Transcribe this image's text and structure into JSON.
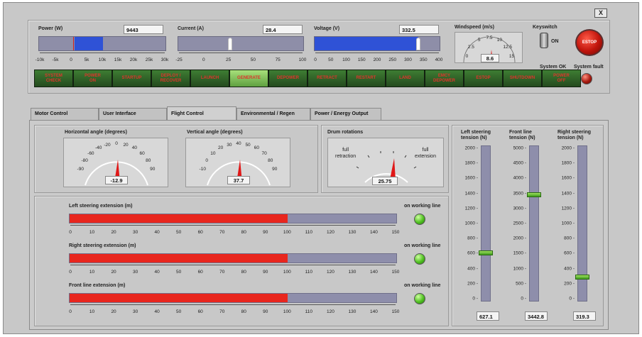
{
  "window": {
    "close_label": "X"
  },
  "power": {
    "label": "Power (W)",
    "value": "9443",
    "ticks": [
      "-10k",
      "-5k",
      "0",
      "5k",
      "10k",
      "15k",
      "20k",
      "25k",
      "30k"
    ],
    "fraction": 0.49
  },
  "current": {
    "label": "Current (A)",
    "value": "28.4",
    "ticks": [
      "-25",
      "0",
      "25",
      "50",
      "75",
      "100"
    ],
    "fraction": 0.41
  },
  "voltage": {
    "label": "Voltage (V)",
    "value": "332.5",
    "ticks": [
      "0",
      "50",
      "100",
      "150",
      "200",
      "250",
      "300",
      "350",
      "400"
    ],
    "fraction": 0.83
  },
  "windspeed": {
    "label": "Windspeed (m/s)",
    "value": "8.6",
    "ticks": [
      "0",
      "2.5",
      "5",
      "7.5",
      "10",
      "12.5",
      "15"
    ]
  },
  "keyswitch": {
    "label": "Keyswitch",
    "state": "ON"
  },
  "estop": {
    "label": "ESTOP"
  },
  "status": {
    "ok_label": "System OK",
    "fault_label": "System fault"
  },
  "buttons": [
    "SYSTEM\nCHECK",
    "POWER\nON",
    "STARTUP",
    "DEPLOY /\nRECOVER",
    "LAUNCH",
    "GENERATE",
    "DEPOWER",
    "RETRACT",
    "RESTART",
    "LAND",
    "EMCY\nDEPOWER",
    "ESTOP",
    "SHUTDOWN",
    "POWER\nOFF"
  ],
  "active_button": "GENERATE",
  "tabs": [
    "Motor Control",
    "User Interface",
    "Flight Control",
    "Environmental / Regen",
    "Power / Energy Output"
  ],
  "active_tab": "Flight Control",
  "horizontal_angle": {
    "label": "Horizontal angle (degrees)",
    "value": "-12.9",
    "ticks": [
      "-90",
      "-80",
      "-60",
      "-40",
      "-20",
      "0",
      "20",
      "40",
      "60",
      "80",
      "90"
    ]
  },
  "vertical_angle": {
    "label": "Vertical angle (degrees)",
    "value": "37.7",
    "ticks": [
      "-10",
      "0",
      "10",
      "20",
      "30",
      "40",
      "50",
      "60",
      "70",
      "80",
      "90"
    ]
  },
  "drum": {
    "label": "Drum rotations",
    "left": "full\nretraction",
    "right": "full\nextension",
    "value": "25.75"
  },
  "extensions": [
    {
      "label": "Left steering extension (m)",
      "value": 100,
      "led_label": "on working line"
    },
    {
      "label": "Right steering extension (m)",
      "value": 100,
      "led_label": "on working line"
    },
    {
      "label": "Front line extension (m)",
      "value": 100,
      "led_label": "on working line"
    }
  ],
  "ext_ticks": [
    "0",
    "10",
    "20",
    "30",
    "40",
    "50",
    "60",
    "70",
    "80",
    "90",
    "100",
    "110",
    "120",
    "130",
    "140",
    "150"
  ],
  "tensions": [
    {
      "label": "Left steering\ntension (N)",
      "value": "627.1",
      "max": 2000,
      "ticks": [
        "2000",
        "1800",
        "1600",
        "1400",
        "1200",
        "1000",
        "800",
        "600",
        "400",
        "200",
        "0"
      ],
      "level": 627.1
    },
    {
      "label": "Front line\ntension (N)",
      "value": "3442.8",
      "max": 5000,
      "ticks": [
        "5000",
        "4500",
        "4000",
        "3500",
        "3000",
        "2500",
        "2000",
        "1500",
        "1000",
        "500",
        "0"
      ],
      "level": 3442.8
    },
    {
      "label": "Right steering\ntension (N)",
      "value": "319.3",
      "max": 2000,
      "ticks": [
        "2000",
        "1800",
        "1600",
        "1400",
        "1200",
        "1000",
        "800",
        "600",
        "400",
        "200",
        "0"
      ],
      "level": 319.3
    }
  ],
  "colors": {
    "bar_blue": "#2f52d6",
    "bar_red": "#e8261e",
    "button_green": "#3e7d33",
    "button_text": "#e0342c"
  }
}
